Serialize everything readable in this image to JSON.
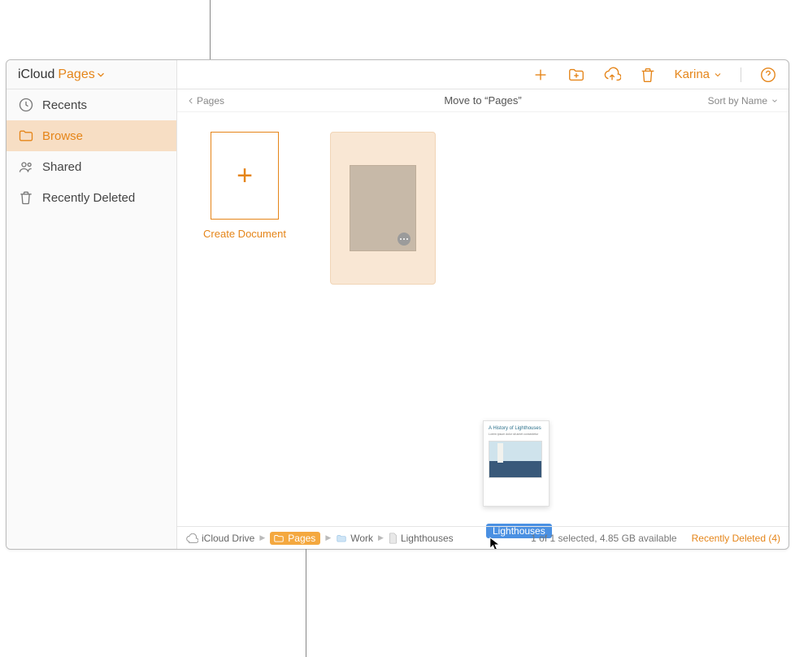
{
  "sidebar": {
    "brand": "iCloud",
    "app": "Pages",
    "items": [
      {
        "icon": "clock",
        "label": "Recents"
      },
      {
        "icon": "folder",
        "label": "Browse",
        "active": true
      },
      {
        "icon": "people",
        "label": "Shared"
      },
      {
        "icon": "trash",
        "label": "Recently Deleted"
      }
    ]
  },
  "toolbar": {
    "user": "Karina"
  },
  "subheader": {
    "back_label": "Pages",
    "title": "Move to “Pages”",
    "sort": "Sort by Name"
  },
  "content": {
    "create_label": "Create Document"
  },
  "drag": {
    "ghost_title": "A History of Lighthouses",
    "label": "Lighthouses"
  },
  "footer": {
    "breadcrumb": [
      {
        "icon": "cloud",
        "label": "iCloud Drive"
      },
      {
        "icon": "folder",
        "label": "Pages",
        "hot": true
      },
      {
        "icon": "folder",
        "label": "Work"
      },
      {
        "icon": "doc",
        "label": "Lighthouses"
      }
    ],
    "status": "1 of 1 selected, 4.85 GB available",
    "recently_deleted": "Recently Deleted (4)"
  }
}
